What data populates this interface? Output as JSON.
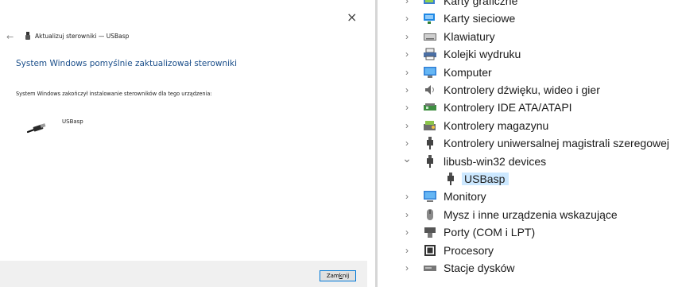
{
  "dialog": {
    "back_arrow": "←",
    "close_glyph": "×",
    "window_title": "Aktualizuj sterowniki — USBasp",
    "headline": "System Windows pomyślnie zaktualizował sterowniki",
    "description": "System Windows zakończył instalowanie sterowników dla tego urządzenia:",
    "device_name": "USBasp",
    "close_button": {
      "pre": "Zam",
      "accel": "k",
      "post": "nij"
    }
  },
  "tree": {
    "items": [
      {
        "label": "Karty graficzne",
        "expanded": false,
        "icon": "display-adapter-icon"
      },
      {
        "label": "Karty sieciowe",
        "expanded": false,
        "icon": "network-adapter-icon"
      },
      {
        "label": "Klawiatury",
        "expanded": false,
        "icon": "keyboard-icon"
      },
      {
        "label": "Kolejki wydruku",
        "expanded": false,
        "icon": "printer-icon"
      },
      {
        "label": "Komputer",
        "expanded": false,
        "icon": "computer-icon"
      },
      {
        "label": "Kontrolery dźwięku, wideo i gier",
        "expanded": false,
        "icon": "speaker-icon"
      },
      {
        "label": "Kontrolery IDE ATA/ATAPI",
        "expanded": false,
        "icon": "ide-controller-icon"
      },
      {
        "label": "Kontrolery magazynu",
        "expanded": false,
        "icon": "storage-controller-icon"
      },
      {
        "label": "Kontrolery uniwersalnej magistrali szeregowej",
        "expanded": false,
        "icon": "usb-controller-icon"
      },
      {
        "label": "libusb-win32 devices",
        "expanded": true,
        "icon": "usb-plug-icon"
      },
      {
        "label": "USBasp",
        "child": true,
        "selected": true,
        "icon": "usb-plug-icon"
      },
      {
        "label": "Monitory",
        "expanded": false,
        "icon": "monitor-icon"
      },
      {
        "label": "Mysz i inne urządzenia wskazujące",
        "expanded": false,
        "icon": "mouse-icon"
      },
      {
        "label": "Porty (COM i LPT)",
        "expanded": false,
        "icon": "port-icon"
      },
      {
        "label": "Procesory",
        "expanded": false,
        "icon": "processor-icon"
      },
      {
        "label": "Stacje dysków",
        "expanded": false,
        "icon": "disk-drive-icon"
      }
    ]
  },
  "colors": {
    "headline": "#1a4e8a",
    "selection": "#cce8ff",
    "button_border": "#0078d7"
  }
}
